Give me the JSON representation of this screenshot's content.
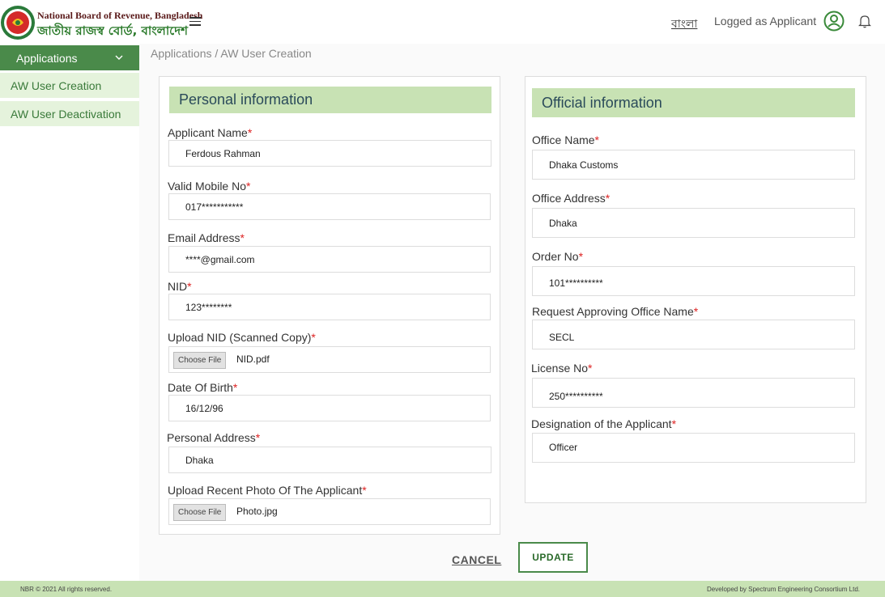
{
  "header": {
    "brand_en": "National Board of Revenue, Bangladesh",
    "brand_bn": "জাতীয় রাজস্ব বোর্ড, বাংলাদেশ",
    "language_link": "বাংলা",
    "logged_as": "Logged as Applicant"
  },
  "sidebar": {
    "main_label": "Applications",
    "items": [
      {
        "label": "AW User Creation"
      },
      {
        "label": "AW User Deactivation"
      }
    ]
  },
  "breadcrumb": "Applications / AW User Creation",
  "personal": {
    "title": "Personal information",
    "applicant_name_label": "Applicant Name",
    "applicant_name": "Ferdous Rahman",
    "mobile_label": "Valid Mobile No",
    "mobile": "017***********",
    "email_label": "Email Address",
    "email": "****@gmail.com",
    "nid_label": "NID",
    "nid": "123********",
    "nid_upload_label": "Upload NID (Scanned Copy)",
    "nid_file": "NID.pdf",
    "dob_label": "Date Of Birth",
    "dob": "16/12/96",
    "address_label": "Personal Address",
    "address": "Dhaka",
    "photo_label": "Upload Recent Photo Of The Applicant",
    "photo_file": "Photo.jpg"
  },
  "official": {
    "title": "Official information",
    "office_name_label": "Office Name",
    "office_name": "Dhaka Customs",
    "office_address_label": "Office Address",
    "office_address": "Dhaka",
    "order_no_label": "Order No",
    "order_no": "101**********",
    "approving_label": "Request Approving Office Name",
    "approving": "SECL",
    "license_label": "License No",
    "license": "250**********",
    "designation_label": "Designation of the Applicant",
    "designation": "Officer"
  },
  "choose_file_label": "Choose File",
  "required_mark": "*",
  "actions": {
    "cancel": "CANCEL",
    "update": "UPDATE"
  },
  "footer": {
    "copyright": "NBR © 2021 All rights reserved.",
    "developer": "Developed by Spectrum Engineering Consortium Ltd."
  },
  "colors": {
    "brand_green": "#4a8a4a",
    "panel_header": "#c8e2b4",
    "sidebar_item_bg": "#e5f3dc",
    "required": "#dd2222"
  }
}
